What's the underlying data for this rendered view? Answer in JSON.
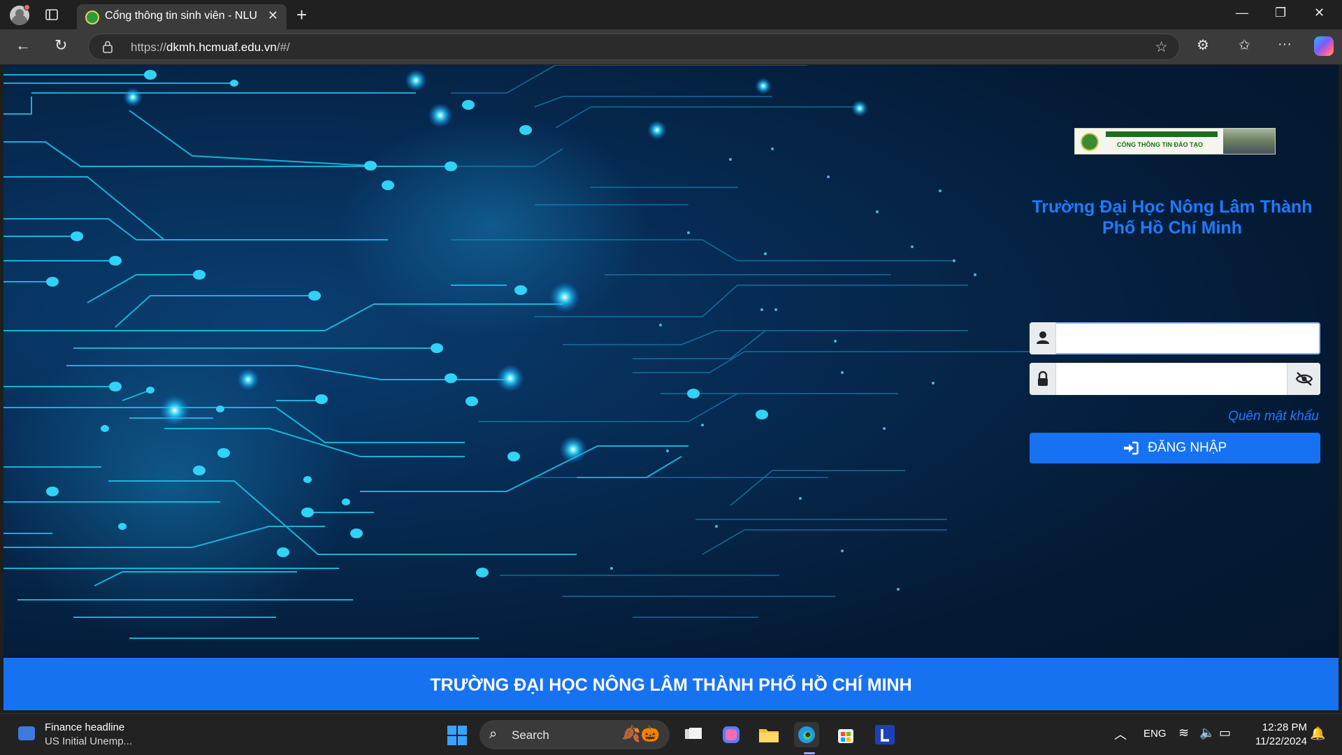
{
  "browser": {
    "tab_title": "Cổng thông tin sinh viên - NLU",
    "url_scheme": "https://",
    "url_host": "dkmh.hcmuaf.edu.vn",
    "url_path": "/#/"
  },
  "banner": {
    "subtitle": "CỔNG THÔNG TIN ĐÀO TẠO"
  },
  "login": {
    "university_line1": "Trường Đại Học Nông Lâm Thành",
    "university_line2": "Phố Hồ Chí Minh",
    "username_value": "",
    "password_value": "",
    "forgot_password": "Quên mật khẩu",
    "login_button": "ĐĂNG NHẬP"
  },
  "footer": {
    "text": "TRƯỜNG ĐẠI HỌC NÔNG LÂM THÀNH PHỐ HỒ CHÍ MINH"
  },
  "taskbar": {
    "widget_title": "Finance headline",
    "widget_subtitle": "US Initial Unemp...",
    "search_label": "Search",
    "language": "ENG",
    "time": "12:28 PM",
    "date": "11/22/2024"
  },
  "colors": {
    "accent_blue": "#1772f2",
    "title_blue": "#1e7bff",
    "circuit_cyan": "#19d3f5",
    "page_dark": "#041a34"
  },
  "icons": [
    "user-icon",
    "lock-icon",
    "eye-slash-icon",
    "sign-in-icon",
    "search-icon",
    "star-icon",
    "refresh-icon",
    "back-icon"
  ]
}
